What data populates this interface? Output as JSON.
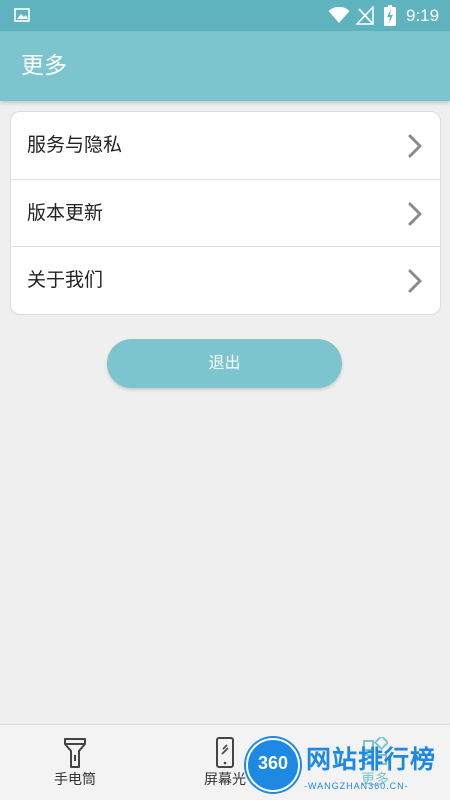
{
  "status_bar": {
    "time": "9:19",
    "icons": [
      "gallery-icon",
      "wifi-icon",
      "no-signal-icon",
      "battery-charging-icon"
    ]
  },
  "app_bar": {
    "title": "更多"
  },
  "menu": {
    "items": [
      {
        "label": "服务与隐私",
        "icon": "chevron-right-icon"
      },
      {
        "label": "版本更新",
        "icon": "chevron-right-icon"
      },
      {
        "label": "关于我们",
        "icon": "chevron-right-icon"
      }
    ]
  },
  "logout": {
    "label": "退出"
  },
  "bottom_nav": {
    "items": [
      {
        "label": "手电筒",
        "icon": "flashlight-icon"
      },
      {
        "label": "屏幕光",
        "icon": "phone-screen-icon"
      },
      {
        "label": "更多",
        "icon": "more-grid-icon"
      }
    ],
    "active_index": 2
  },
  "watermark": {
    "badge": "360",
    "title": "网站排行榜",
    "url": "-WANGZHAN360.CN-"
  },
  "colors": {
    "status_bar": "#5fb3bf",
    "accent": "#7cc5ce",
    "background": "#efefef",
    "watermark": "#1e88e5"
  }
}
